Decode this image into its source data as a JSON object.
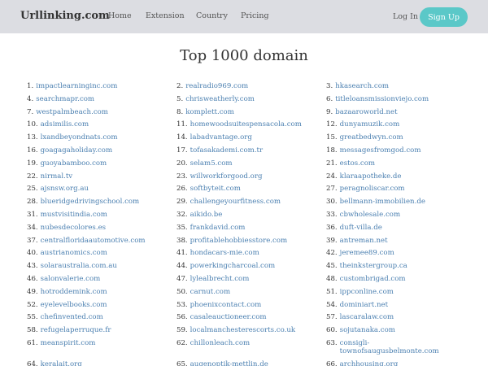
{
  "navbar": {
    "brand": "Urllinking.com",
    "links": [
      "Home",
      "Extension",
      "Country",
      "Pricing"
    ],
    "login": "Log In",
    "signup": "Sign Up"
  },
  "page_title": "Top 1000 domain",
  "domains": [
    {
      "num": "1.",
      "name": "impactlearninginc.com"
    },
    {
      "num": "2.",
      "name": "realradio969.com"
    },
    {
      "num": "3.",
      "name": "hkasearch.com"
    },
    {
      "num": "4.",
      "name": "searchmapr.com"
    },
    {
      "num": "5.",
      "name": "chrisweatherly.com"
    },
    {
      "num": "6.",
      "name": "titleloansmissionviejo.com"
    },
    {
      "num": "7.",
      "name": "westpalmbeach.com"
    },
    {
      "num": "8.",
      "name": "komplett.com"
    },
    {
      "num": "9.",
      "name": "bazaaroworld.net"
    },
    {
      "num": "10.",
      "name": "adsimilis.com"
    },
    {
      "num": "11.",
      "name": "homewoodsuitespensacola.com"
    },
    {
      "num": "12.",
      "name": "dunyamuzik.com"
    },
    {
      "num": "13.",
      "name": "lxandbeyondnats.com"
    },
    {
      "num": "14.",
      "name": "labadvantage.org"
    },
    {
      "num": "15.",
      "name": "greatbedwyn.com"
    },
    {
      "num": "16.",
      "name": "goagagaholiday.com"
    },
    {
      "num": "17.",
      "name": "tofasakademi.com.tr"
    },
    {
      "num": "18.",
      "name": "messagesfromgod.com"
    },
    {
      "num": "19.",
      "name": "guoyabamboo.com"
    },
    {
      "num": "20.",
      "name": "selam5.com"
    },
    {
      "num": "21.",
      "name": "estos.com"
    },
    {
      "num": "22.",
      "name": "nirmal.tv"
    },
    {
      "num": "23.",
      "name": "willworkforgood.org"
    },
    {
      "num": "24.",
      "name": "klaraapotheke.de"
    },
    {
      "num": "25.",
      "name": "ajsnsw.org.au"
    },
    {
      "num": "26.",
      "name": "softbyteit.com"
    },
    {
      "num": "27.",
      "name": "peragnoliscar.com"
    },
    {
      "num": "28.",
      "name": "blueridgedrivingschool.com"
    },
    {
      "num": "29.",
      "name": "challengeyourfitness.com"
    },
    {
      "num": "30.",
      "name": "bellmann-immobilien.de"
    },
    {
      "num": "31.",
      "name": "mustvisitindia.com"
    },
    {
      "num": "32.",
      "name": "aikido.be"
    },
    {
      "num": "33.",
      "name": "cbwholesale.com"
    },
    {
      "num": "34.",
      "name": "nubesdecolores.es"
    },
    {
      "num": "35.",
      "name": "frankdavid.com"
    },
    {
      "num": "36.",
      "name": "duft-villa.de"
    },
    {
      "num": "37.",
      "name": "centralfloridaautomotive.com"
    },
    {
      "num": "38.",
      "name": "profitablehobbiesstore.com"
    },
    {
      "num": "39.",
      "name": "antreman.net"
    },
    {
      "num": "40.",
      "name": "austrianomics.com"
    },
    {
      "num": "41.",
      "name": "hondacars-mie.com"
    },
    {
      "num": "42.",
      "name": "jeremee89.com"
    },
    {
      "num": "43.",
      "name": "solaraustralia.com.au"
    },
    {
      "num": "44.",
      "name": "powerkingcharcoal.com"
    },
    {
      "num": "45.",
      "name": "theinkstergroup.ca"
    },
    {
      "num": "46.",
      "name": "salonvalerie.com"
    },
    {
      "num": "47.",
      "name": "lylealbrecht.com"
    },
    {
      "num": "48.",
      "name": "custombrigad.com"
    },
    {
      "num": "49.",
      "name": "hotroddemink.com"
    },
    {
      "num": "50.",
      "name": "carnut.com"
    },
    {
      "num": "51.",
      "name": "ippconline.com"
    },
    {
      "num": "52.",
      "name": "eyelevelbooks.com"
    },
    {
      "num": "53.",
      "name": "phoenixcontact.com"
    },
    {
      "num": "54.",
      "name": "dominiart.net"
    },
    {
      "num": "55.",
      "name": "chefinvented.com"
    },
    {
      "num": "56.",
      "name": "casaleauctioneer.com"
    },
    {
      "num": "57.",
      "name": "lascaralaw.com"
    },
    {
      "num": "58.",
      "name": "refugelaperruque.fr"
    },
    {
      "num": "59.",
      "name": "localmanchesterescorts.co.uk"
    },
    {
      "num": "60.",
      "name": "sojutanaka.com"
    },
    {
      "num": "61.",
      "name": "meanspirit.com"
    },
    {
      "num": "62.",
      "name": "chillonleach.com"
    },
    {
      "num": "63.",
      "name": "consigli-townofsaugusbelmonte.com"
    },
    {
      "num": "64.",
      "name": "keralait.org"
    },
    {
      "num": "65.",
      "name": "augenoptik-mettlin.de"
    },
    {
      "num": "66.",
      "name": "archhousing.org"
    }
  ]
}
